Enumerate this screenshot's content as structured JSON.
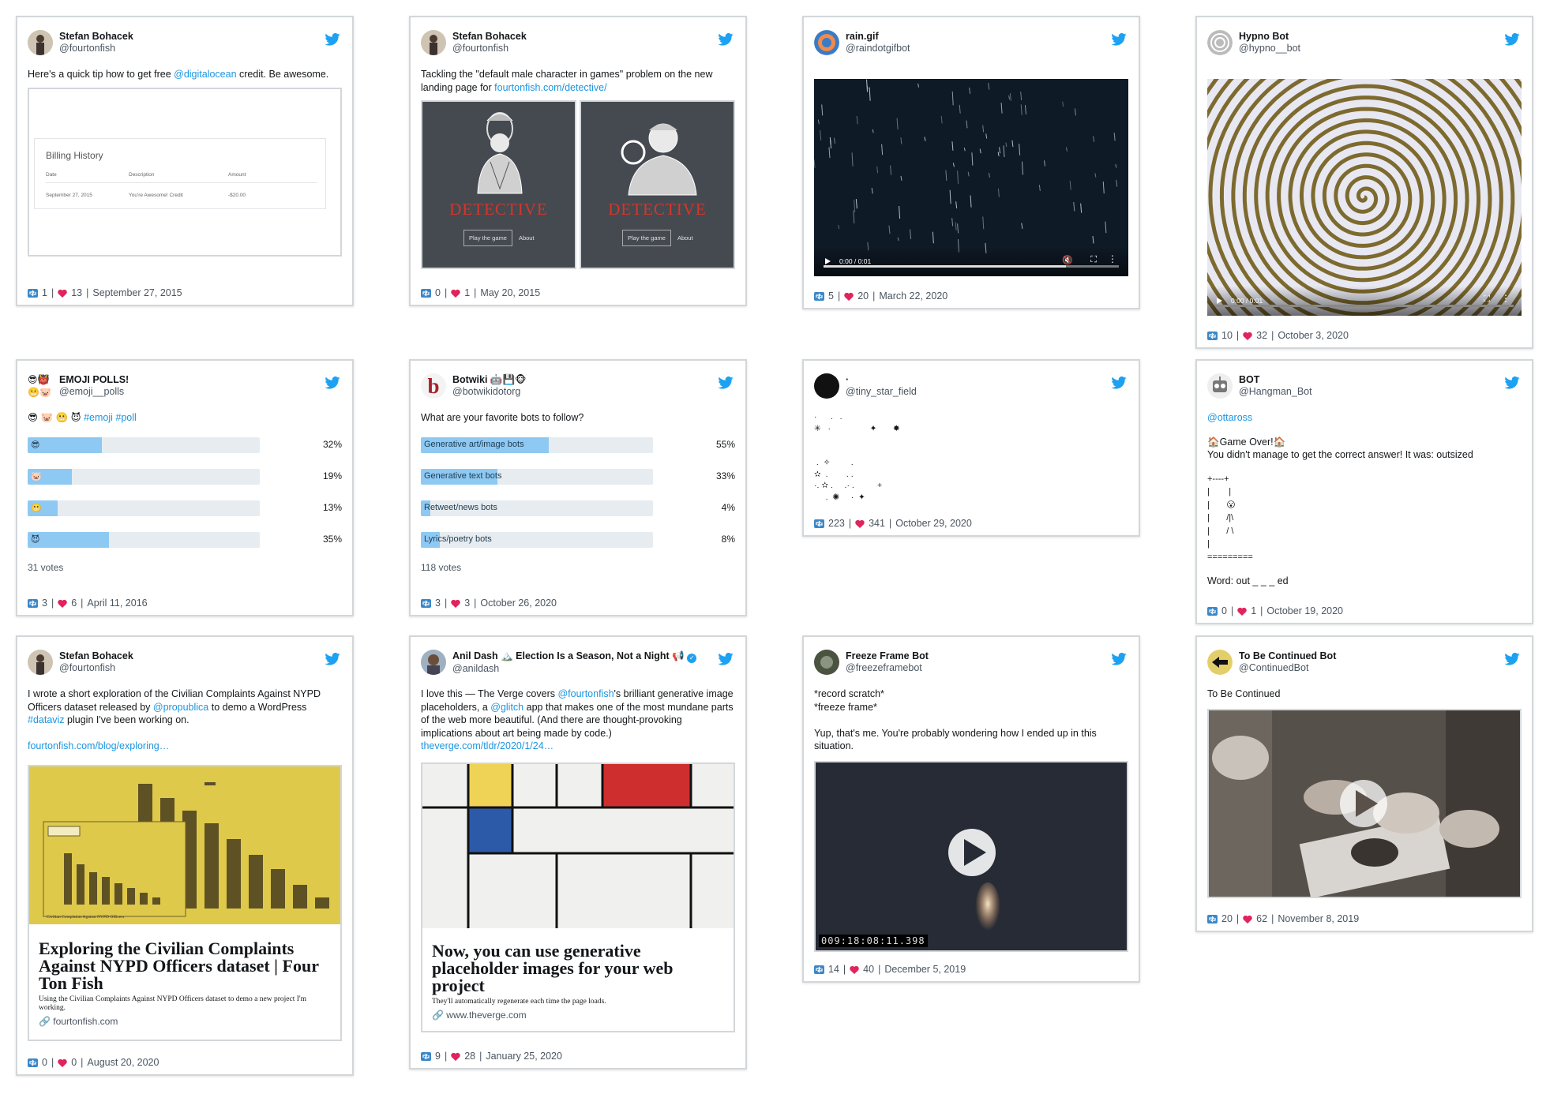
{
  "card1": {
    "name": "Stefan Bohacek",
    "handle": "@fourtonfish",
    "text_a": "Here's a quick tip how to get free ",
    "link_a": "@digitalocean",
    "text_b": " credit. Be awesome.",
    "billing": {
      "title": "Billing History",
      "col_date": "Date",
      "col_desc": "Description",
      "col_amt": "Amount",
      "row_date": "September 27, 2015",
      "row_desc": "You're Awesome! Credit",
      "row_amt": "-$20.00"
    },
    "retweets": "1",
    "likes": "13",
    "date": "September 27, 2015"
  },
  "card2": {
    "name": "Stefan Bohacek",
    "handle": "@fourtonfish",
    "text_a": "Tackling the \"default male character in games\" problem on the new landing page for ",
    "link_a": "fourtonfish.com/detective/",
    "left": {
      "title": "DETECTIVE",
      "play": "Play the game",
      "about": "About"
    },
    "right": {
      "title": "DETECTIVE",
      "play": "Play the game",
      "about": "About"
    },
    "retweets": "0",
    "likes": "1",
    "date": "May 20, 2015"
  },
  "card3": {
    "name": "rain.gif",
    "handle": "@raindotgifbot",
    "time": "0:00 / 0:01",
    "retweets": "5",
    "likes": "20",
    "date": "March 22, 2020"
  },
  "card4": {
    "name": "Hypno Bot",
    "handle": "@hypno__bot",
    "time": "0:00 / 0:01",
    "retweets": "10",
    "likes": "32",
    "date": "October 3, 2020"
  },
  "card5": {
    "name": "EMOJI POLLS!",
    "handle": "@emoji__polls",
    "avatar_emoji": [
      "😎",
      "👹",
      "😬",
      "🐷"
    ],
    "text_emoji": "😎 🐷 😬 😈 ",
    "tag1": "#emoji",
    "tag2": "#poll",
    "options": [
      {
        "label": "😎",
        "pct": "32%",
        "fill": 0.32
      },
      {
        "label": "🐷",
        "pct": "19%",
        "fill": 0.19
      },
      {
        "label": "😬",
        "pct": "13%",
        "fill": 0.13
      },
      {
        "label": "😈",
        "pct": "35%",
        "fill": 0.35
      }
    ],
    "votes": "31 votes",
    "retweets": "3",
    "likes": "6",
    "date": "April 11, 2016"
  },
  "card6": {
    "name": "Botwiki 🤖💾🐵",
    "handle": "@botwikidotorg",
    "avatar_letter": "b",
    "text": "What are your favorite bots to follow?",
    "options": [
      {
        "label": "Generative art/image bots",
        "pct": "55%",
        "fill": 0.55
      },
      {
        "label": "Generative text bots",
        "pct": "33%",
        "fill": 0.33
      },
      {
        "label": "Retweet/news bots",
        "pct": "4%",
        "fill": 0.04
      },
      {
        "label": "Lyrics/poetry bots",
        "pct": "8%",
        "fill": 0.08
      }
    ],
    "votes": "118 votes",
    "retweets": "3",
    "likes": "3",
    "date": "October 26, 2020"
  },
  "card7": {
    "name": "·",
    "handle": "@tiny_star_field",
    "stars": "·      .   .\n✳   ·                 ✦       ✸\n\n\n .  ✧         .\n✫  .        . .\n·. ✫ .     .· .          +\n     .  ✺     ·  ✦",
    "retweets": "223",
    "likes": "341",
    "date": "October 29, 2020"
  },
  "card8": {
    "name": "BOT",
    "handle": "@Hangman_Bot",
    "mention": "@ottaross",
    "text": "🏠Game Over!🏠\nYou didn't manage to get the correct answer! It was: outsized",
    "art": "+----+\n|        |\n|       😮\n|       /|\\\n|       / \\\n|\n=========",
    "word": "Word: out _ _ _ ed",
    "retweets": "0",
    "likes": "1",
    "date": "October 19, 2020"
  },
  "card9": {
    "name": "Stefan Bohacek",
    "handle": "@fourtonfish",
    "text_a": "I wrote a short exploration of the Civilian Complaints Against NYPD Officers dataset released by ",
    "link_a": "@propublica",
    "text_b": " to demo a WordPress ",
    "link_b": "#dataviz",
    "text_c": " plugin I've been working on.",
    "link_c": "fourtonfish.com/blog/exploring…",
    "chart_caption": "Civilian Complaints Against NYPD Officers",
    "l_title": "Exploring the Civilian Complaints Against NYPD Officers dataset | Four Ton Fish",
    "l_desc": "Using the Civilian Complaints Against NYPD Officers dataset to demo a new project I'm working.",
    "l_domain": "fourtonfish.com",
    "retweets": "0",
    "likes": "0",
    "date": "August 20, 2020"
  },
  "card10": {
    "name": "Anil Dash 🏔️ Election Is a Season, Not a Night 📢",
    "handle": "@anildash",
    "text_a": "I love this — The Verge covers ",
    "link_a": "@fourtonfish",
    "text_b": "'s brilliant generative image placeholders, a ",
    "link_b": "@glitch",
    "text_c": " app that makes one of the most mundane parts of the web more beautiful. (And there are thought-provoking implications about art being made by code.) ",
    "link_c": "theverge.com/tldr/2020/1/24…",
    "l_title": "Now, you can use generative placeholder images for your web project",
    "l_desc": "They'll automatically regenerate each time the page loads.",
    "l_domain": "www.theverge.com",
    "retweets": "9",
    "likes": "28",
    "date": "January 25, 2020"
  },
  "card11": {
    "name": "Freeze Frame Bot",
    "handle": "@freezeframebot",
    "text": "*record scratch*\n*freeze frame*\n\nYup, that's me. You're probably wondering how I ended up in this situation.",
    "timecode": "009:18:08:11.398",
    "retweets": "14",
    "likes": "40",
    "date": "December 5, 2019"
  },
  "card12": {
    "name": "To Be Continued Bot",
    "handle": "@ContinuedBot",
    "text": "To Be Continued",
    "retweets": "20",
    "likes": "62",
    "date": "November 8, 2019"
  },
  "colors": {
    "link": "#1b95e0",
    "twitter": "#1da1f2",
    "heart": "#e0245e",
    "retweet": "#3a88c9",
    "poll_fill": "#8ec9f3",
    "detective_red": "#d2362c"
  }
}
